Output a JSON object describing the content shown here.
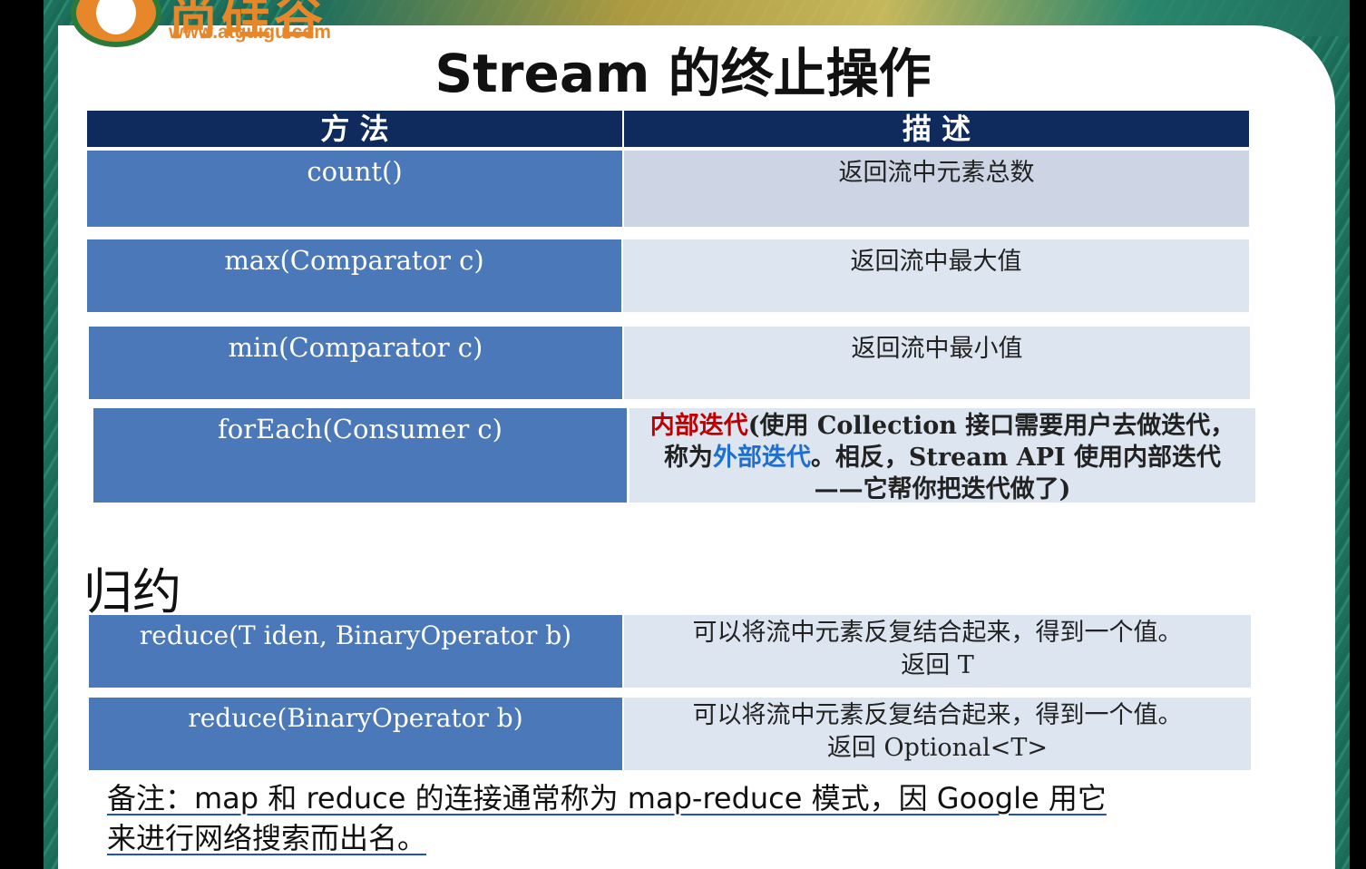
{
  "logo": {
    "brand_text": "尚硅谷",
    "url": "www.atguigu.com"
  },
  "title": "Stream 的终止操作",
  "table_headers": {
    "method": "方 法",
    "description": "描 述"
  },
  "terminal_ops": [
    {
      "method": "count()",
      "description": "返回流中元素总数"
    },
    {
      "method": "max(Comparator c)",
      "description": "返回流中最大值"
    },
    {
      "method": "min(Comparator c)",
      "description": "返回流中最小值"
    },
    {
      "method": "forEach(Consumer c)",
      "description_parts": {
        "p1": "内部迭代",
        "p2": "(使用 Collection 接口需要用户去做迭代，称为",
        "p3": "外部迭代",
        "p4": "。相反，Stream API 使用内部迭代——它帮你把迭代做了)"
      }
    }
  ],
  "section_title": "归约",
  "reduce_ops": [
    {
      "method": "reduce(T iden, BinaryOperator b)",
      "description_line1": "可以将流中元素反复结合起来，得到一个值。",
      "description_line2": "返回 T"
    },
    {
      "method": "reduce(BinaryOperator b)",
      "description_line1": "可以将流中元素反复结合起来，得到一个值。",
      "description_line2": "返回 Optional<T>"
    }
  ],
  "note": {
    "line1": "备注：map 和 reduce 的连接通常称为 map-reduce 模式，因 Google 用它",
    "line2": "来进行网络搜索而出名。"
  },
  "colors": {
    "header_bg": "#0f2a5c",
    "method_bg": "#4a78b8",
    "desc_bg_1": "#cdd5e4",
    "desc_bg_2": "#dde5f0",
    "red": "#c00000",
    "blue": "#1f6fd0"
  }
}
